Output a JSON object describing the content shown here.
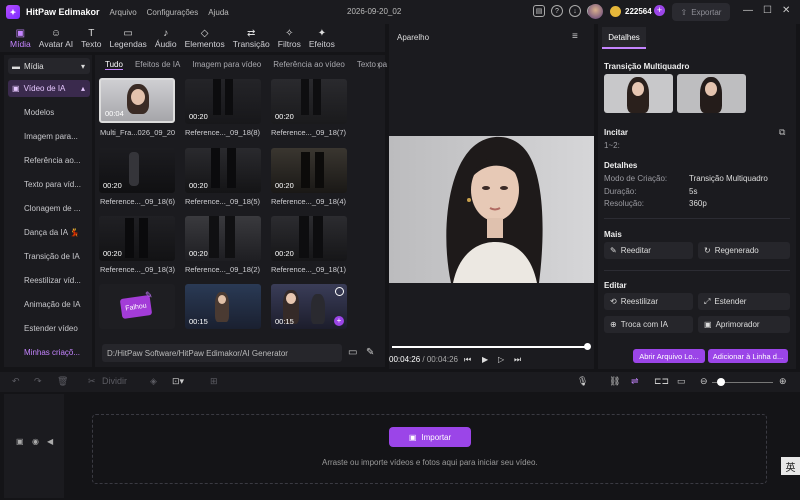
{
  "titlebar": {
    "app_name": "HitPaw Edimakor",
    "menu": [
      "Arquivo",
      "Configurações",
      "Ajuda"
    ],
    "doc_title": "2026-09-20_02",
    "credits": "222564",
    "export_label": "Exportar"
  },
  "toolbar": {
    "tools": [
      {
        "label": "Mídia",
        "icon": "media-icon"
      },
      {
        "label": "Avatar AI",
        "icon": "avatar-icon"
      },
      {
        "label": "Texto",
        "icon": "text-icon"
      },
      {
        "label": "Legendas",
        "icon": "captions-icon"
      },
      {
        "label": "Áudio",
        "icon": "audio-icon"
      },
      {
        "label": "Elementos",
        "icon": "elements-icon"
      },
      {
        "label": "Transição",
        "icon": "transition-icon"
      },
      {
        "label": "Filtros",
        "icon": "filters-icon"
      },
      {
        "label": "Efeitos",
        "icon": "effects-icon"
      }
    ]
  },
  "sidebar": {
    "media_label": "Mídia",
    "video_ai_label": "Vídeo de IA",
    "items": [
      "Modelos",
      "Imagem para...",
      "Referência ao...",
      "Texto para víd...",
      "Clonagem de ...",
      "Dança da IA 💃",
      "Transição de IA",
      "Reestilizar víd...",
      "Animação de IA",
      "Estender vídeo",
      "Minhas criaçõ..."
    ]
  },
  "media": {
    "tabs": [
      "Tudo",
      "Efeitos de IA",
      "Imagem para vídeo",
      "Referência ao vídeo",
      "Texto pa"
    ],
    "thumbs": [
      {
        "label": "Multi_Fra...026_09_20",
        "duration": "00:04"
      },
      {
        "label": "Reference..._09_18(8)",
        "duration": "00:20"
      },
      {
        "label": "Reference..._09_18(7)",
        "duration": "00:20"
      },
      {
        "label": "Reference..._09_18(6)",
        "duration": "00:20"
      },
      {
        "label": "Reference..._09_18(5)",
        "duration": "00:20"
      },
      {
        "label": "Reference..._09_18(4)",
        "duration": "00:20"
      },
      {
        "label": "Reference..._09_18(3)",
        "duration": "00:20"
      },
      {
        "label": "Reference..._09_18(2)",
        "duration": "00:20"
      },
      {
        "label": "Reference..._09_18(1)",
        "duration": "00:20"
      },
      {
        "label": "",
        "duration": "Falhou"
      },
      {
        "label": "",
        "duration": "00:15"
      },
      {
        "label": "",
        "duration": "00:15"
      }
    ],
    "path": "D:/HitPaw Software/HitPaw Edimakor/AI Generator"
  },
  "preview": {
    "title": "Aparelho",
    "current_time": "00:04:26",
    "total_time": "/ 00:04:26",
    "progress": 1.0
  },
  "details": {
    "tab": "Detalhes",
    "transition_title": "Transição Multiquadro",
    "prompt_title": "Incitar",
    "prompt_value": "1~2:",
    "details_title": "Detalhes",
    "rows": [
      {
        "key": "Modo de Criação:",
        "value": "Transição Multiquadro"
      },
      {
        "key": "Duração:",
        "value": "5s"
      },
      {
        "key": "Resolução:",
        "value": "360p"
      }
    ],
    "more_title": "Mais",
    "more_buttons": [
      "Reeditar",
      "Regenerado"
    ],
    "edit_title": "Editar",
    "edit_buttons": [
      "Reestilizar",
      "Estender",
      "Troca com IA",
      "Aprimorador"
    ],
    "open_file": "Abrir Arquivo Lo...",
    "add_to_timeline": "Adicionar à Linha d..."
  },
  "timeline_toolbar": {
    "split_label": "Dividir"
  },
  "timeline": {
    "import_label": "Importar",
    "drop_text": "Arraste ou importe vídeos e fotos aqui para iniciar seu vídeo.",
    "ime_char": "英"
  }
}
